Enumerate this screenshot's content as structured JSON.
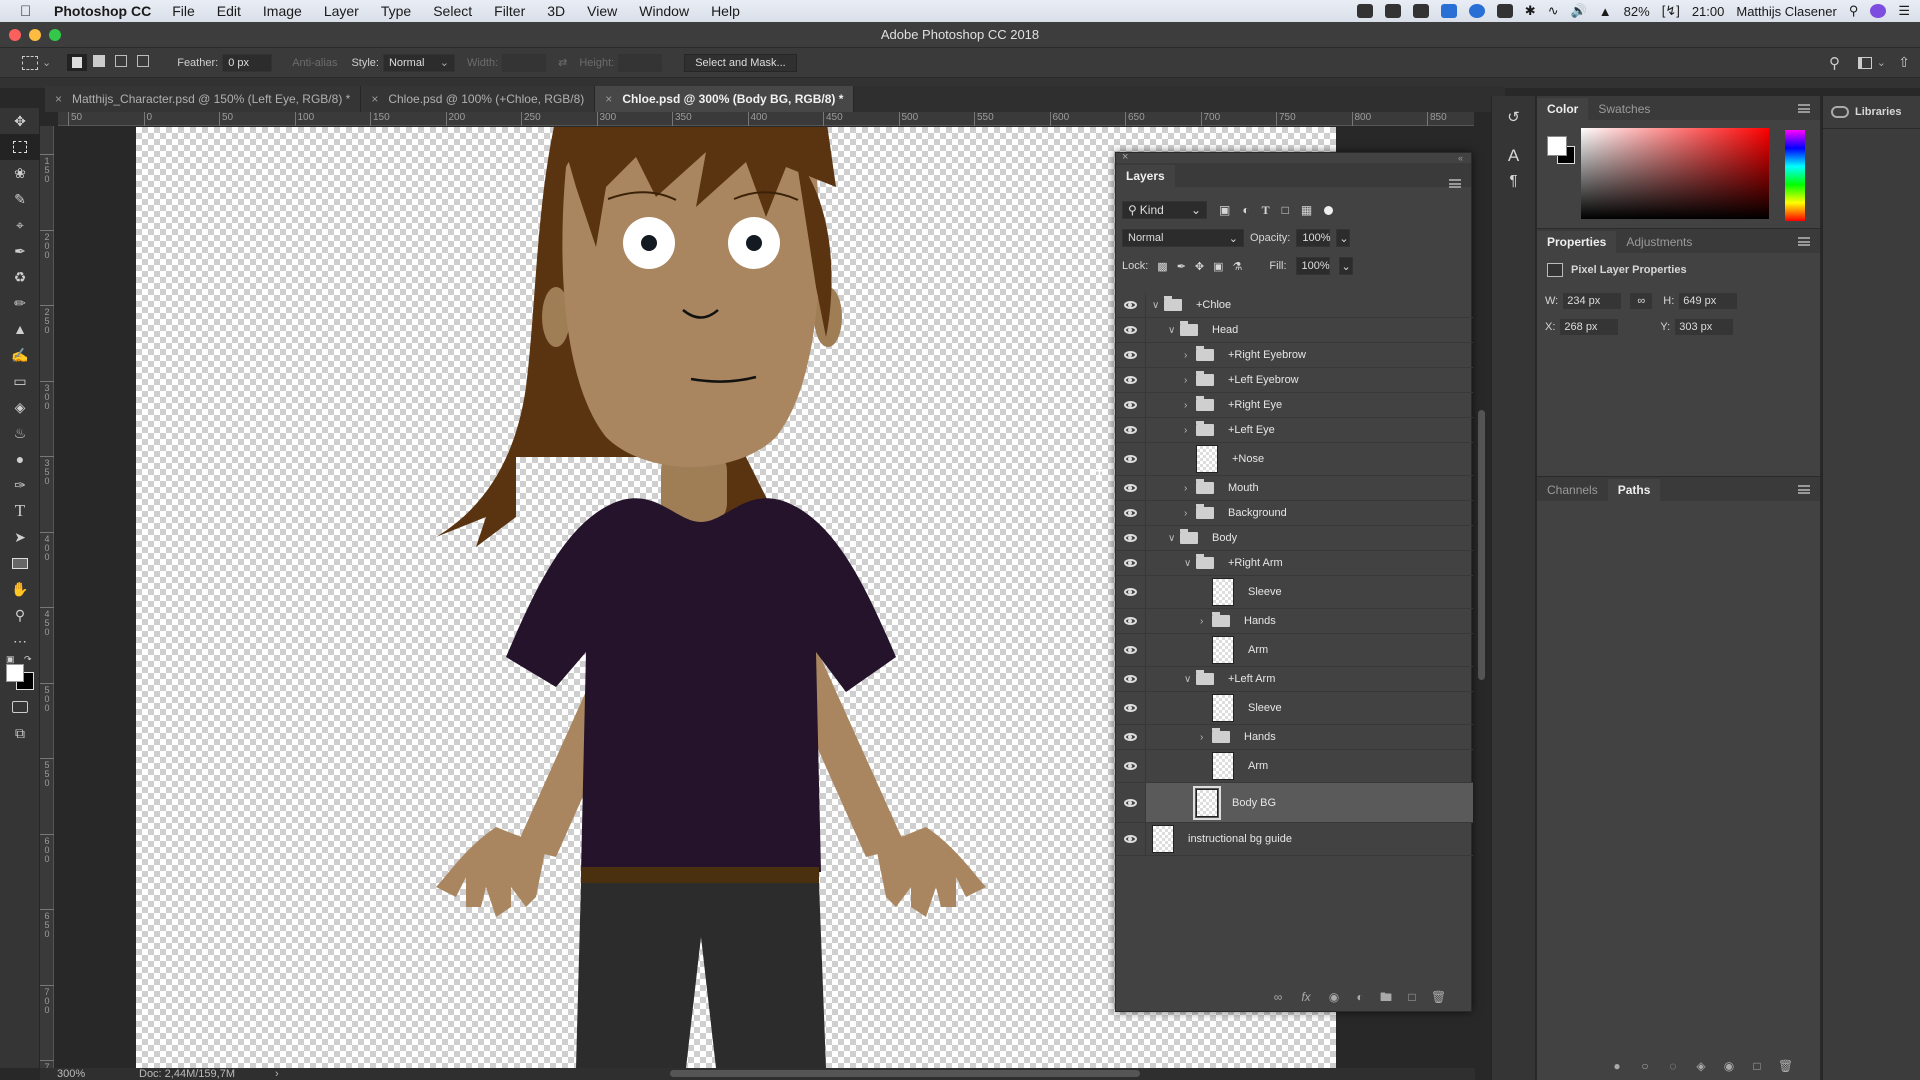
{
  "menubar": {
    "app": "Photoshop CC",
    "items": [
      "File",
      "Edit",
      "Image",
      "Layer",
      "Type",
      "Select",
      "Filter",
      "3D",
      "View",
      "Window",
      "Help"
    ],
    "battery": "82%",
    "time": "21:00",
    "user": "Matthijs Clasener"
  },
  "window": {
    "title": "Adobe Photoshop CC 2018"
  },
  "options": {
    "feather_label": "Feather:",
    "feather_value": "0 px",
    "anti_alias": "Anti-alias",
    "style_label": "Style:",
    "style_value": "Normal",
    "width_label": "Width:",
    "height_label": "Height:",
    "select_mask": "Select and Mask..."
  },
  "doc_tabs": [
    {
      "label": "Matthijs_Character.psd @ 150% (Left Eye, RGB/8) *",
      "active": false
    },
    {
      "label": "Chloe.psd @ 100% (+Chloe, RGB/8)",
      "active": false
    },
    {
      "label": "Chloe.psd @ 300% (Body BG, RGB/8) *",
      "active": true
    }
  ],
  "ruler": {
    "h": [
      "50",
      "0",
      "50",
      "100",
      "150",
      "200",
      "250",
      "300",
      "350",
      "400",
      "450",
      "500",
      "550",
      "600",
      "650",
      "700",
      "750",
      "800",
      "850"
    ],
    "v": [
      "1\n5\n0",
      "2\n0\n0",
      "2\n5\n0",
      "3\n0\n0",
      "3\n5\n0",
      "4\n0\n0",
      "4\n5\n0",
      "5\n0\n0",
      "5\n5\n0",
      "6\n0\n0",
      "6\n5\n0",
      "7\n0\n0",
      "7"
    ]
  },
  "status": {
    "zoom": "300%",
    "doc": "Doc: 2,44M/159,7M"
  },
  "layers_panel": {
    "title": "Layers",
    "kind": "Kind",
    "blend": "Normal",
    "opacity_label": "Opacity:",
    "opacity": "100%",
    "lock_label": "Lock:",
    "fill_label": "Fill:",
    "fill": "100%",
    "layers": [
      {
        "name": "+Chloe",
        "type": "group",
        "depth": 0,
        "open": true
      },
      {
        "name": "Head",
        "type": "group",
        "depth": 1,
        "open": true
      },
      {
        "name": "+Right Eyebrow",
        "type": "group",
        "depth": 2,
        "open": false
      },
      {
        "name": "+Left Eyebrow",
        "type": "group",
        "depth": 2,
        "open": false
      },
      {
        "name": "+Right Eye",
        "type": "group",
        "depth": 2,
        "open": false
      },
      {
        "name": "+Left Eye",
        "type": "group",
        "depth": 2,
        "open": false
      },
      {
        "name": "+Nose",
        "type": "pixel",
        "depth": 2
      },
      {
        "name": "Mouth",
        "type": "group",
        "depth": 2,
        "open": false
      },
      {
        "name": "Background",
        "type": "group",
        "depth": 2,
        "open": false
      },
      {
        "name": "Body",
        "type": "group",
        "depth": 1,
        "open": true
      },
      {
        "name": "+Right Arm",
        "type": "group",
        "depth": 2,
        "open": true
      },
      {
        "name": "Sleeve",
        "type": "pixel",
        "depth": 3
      },
      {
        "name": "Hands",
        "type": "group",
        "depth": 3,
        "open": false
      },
      {
        "name": "Arm",
        "type": "pixel",
        "depth": 3
      },
      {
        "name": "+Left Arm",
        "type": "group",
        "depth": 2,
        "open": true
      },
      {
        "name": "Sleeve",
        "type": "pixel",
        "depth": 3
      },
      {
        "name": "Hands",
        "type": "group",
        "depth": 3,
        "open": false
      },
      {
        "name": "Arm",
        "type": "pixel",
        "depth": 3
      },
      {
        "name": "Body BG",
        "type": "pixel",
        "depth": 2,
        "selected": true
      },
      {
        "name": "instructional bg guide",
        "type": "pixel",
        "depth": 0
      }
    ]
  },
  "color_panel": {
    "tabs": [
      "Color",
      "Swatches"
    ],
    "active": "Color"
  },
  "properties_panel": {
    "tabs": [
      "Properties",
      "Adjustments"
    ],
    "active": "Properties",
    "heading": "Pixel Layer Properties",
    "w_label": "W:",
    "w": "234 px",
    "h_label": "H:",
    "h": "649 px",
    "x_label": "X:",
    "x": "268 px",
    "y_label": "Y:",
    "y": "303 px"
  },
  "paths_panel": {
    "tabs": [
      "Channels",
      "Paths"
    ],
    "active": "Paths"
  },
  "libraries": {
    "label": "Libraries"
  },
  "colors": {
    "accent_selected_layer": "#5a5a5a",
    "shirt": "#24132a",
    "skin": "#a9865f",
    "hair": "#5a3310"
  }
}
